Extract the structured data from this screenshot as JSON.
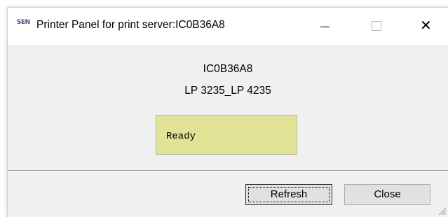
{
  "window": {
    "title": "Printer Panel for print server:IC0B36A8",
    "app_icon_text": "SEN",
    "controls": {
      "minimize_icon": "minimize-icon",
      "maximize_icon": "maximize-icon",
      "close_icon": "close-icon",
      "close_glyph": "✕"
    }
  },
  "panel": {
    "server_name": "IC0B36A8",
    "printer_model": "LP 3235_LP 4235",
    "status": "Ready",
    "status_color": "#e1e497"
  },
  "buttons": {
    "refresh_label": "Refresh",
    "close_label": "Close"
  }
}
